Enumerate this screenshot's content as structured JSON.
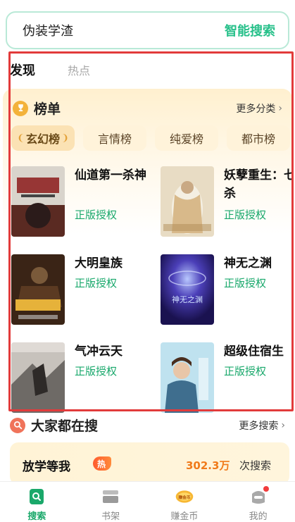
{
  "search": {
    "query": "伪装学渣",
    "button_label": "智能搜索"
  },
  "tabs": [
    {
      "label": "发现"
    },
    {
      "label": "热点"
    }
  ],
  "ranking": {
    "title": "榜单",
    "more_label": "更多分类",
    "categories": [
      {
        "label": "玄幻榜"
      },
      {
        "label": "言情榜"
      },
      {
        "label": "纯爱榜"
      },
      {
        "label": "都市榜"
      }
    ],
    "books": [
      {
        "title": "仙道第一杀神",
        "tag": "正版授权"
      },
      {
        "title": "妖孽重生：七杀",
        "tag": "正版授权"
      },
      {
        "title": "大明皇族",
        "tag": "正版授权"
      },
      {
        "title": "神无之渊",
        "tag": "正版授权"
      },
      {
        "title": "气冲云天",
        "tag": "正版授权"
      },
      {
        "title": "超级住宿生",
        "tag": "正版授权"
      }
    ],
    "cover_texts": {
      "cover3": "神无之渊"
    }
  },
  "popular": {
    "title": "大家都在搜",
    "more_label": "更多搜索",
    "top_item": {
      "title": "放学等我",
      "badge": "热",
      "count": "302.3万",
      "count_suffix": "次搜索"
    }
  },
  "bottom_nav": [
    {
      "label": "搜索",
      "icon": "search-book-icon"
    },
    {
      "label": "书架",
      "icon": "bookshelf-icon"
    },
    {
      "label": "赚金币",
      "icon": "gold-coin-icon",
      "icon_text": "赚金币"
    },
    {
      "label": "我的",
      "icon": "profile-icon"
    }
  ],
  "colors": {
    "accent": "#27c08a",
    "highlight": "#e23b3b",
    "tag_green": "#18a86b"
  }
}
